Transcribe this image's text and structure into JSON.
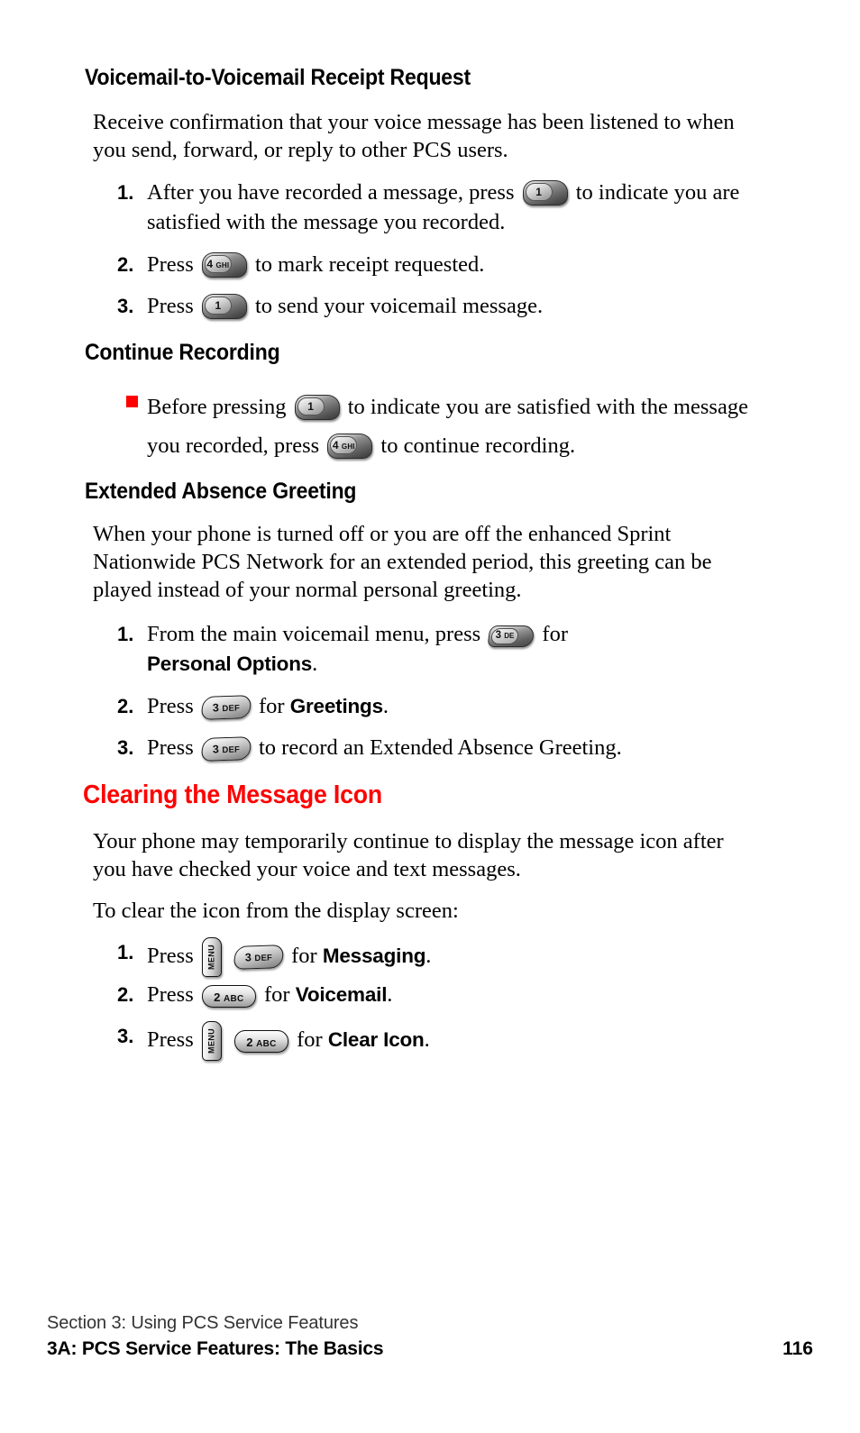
{
  "sections": {
    "voicemail_receipt": {
      "heading": "Voicemail-to-Voicemail Receipt Request",
      "intro": "Receive confirmation that your voice message has been listened to when you send, forward, or reply to other PCS users.",
      "steps": [
        {
          "number": "1.",
          "text_before": "After you have recorded a message, press",
          "key": "1",
          "text_after": "to indicate you are satisfied with the message you recorded."
        },
        {
          "number": "2.",
          "text_before": "Press",
          "key": "4 GHI",
          "text_after": "to mark receipt requested."
        },
        {
          "number": "3.",
          "text_before": "Press",
          "key": "1",
          "text_after": "to send your voicemail message."
        }
      ]
    },
    "continue_recording": {
      "heading": "Continue Recording",
      "bullet": {
        "text_before": "Before pressing",
        "key1": "1",
        "text_middle": "to indicate you are satisfied with the message you recorded, press",
        "key2": "4 GHI",
        "text_after": "to continue recording."
      }
    },
    "extended_absence": {
      "heading": "Extended Absence Greeting",
      "intro": "When your phone is turned off or you are off the enhanced Sprint Nationwide PCS Network for an extended period, this greeting can be played instead of your normal personal greeting.",
      "steps": [
        {
          "number": "1.",
          "text_before": "From the main voicemail menu, press",
          "key": "3 DE",
          "text_after": "for",
          "emphasis": "Personal Options",
          "text_end": "."
        },
        {
          "number": "2.",
          "text_before": "Press",
          "key": "3 DEF",
          "text_after": "for",
          "emphasis": "Greetings",
          "text_end": "."
        },
        {
          "number": "3.",
          "text_before": "Press",
          "key": "3 DEF",
          "text_after": "to record an Extended Absence Greeting.",
          "emphasis": "",
          "text_end": ""
        }
      ]
    },
    "clearing_message_icon": {
      "heading": "Clearing the Message Icon",
      "heading_color": "#ff0000",
      "intro": "Your phone may temporarily continue to display the message icon after you have checked your voice and text messages.",
      "lead_in": "To clear the icon from the display screen:",
      "steps": [
        {
          "number": "1.",
          "text_before": "Press",
          "key_menu": "MENU",
          "key": "3 DEF",
          "text_after": "for",
          "emphasis": "Messaging",
          "text_end": "."
        },
        {
          "number": "2.",
          "text_before": "Press",
          "key_menu": "",
          "key": "2 ABC",
          "text_after": "for",
          "emphasis": "Voicemail",
          "text_end": "."
        },
        {
          "number": "3.",
          "text_before": "Press",
          "key_menu": "MENU",
          "key": "2 ABC",
          "text_after": "for",
          "emphasis": "Clear Icon",
          "text_end": "."
        }
      ]
    }
  },
  "keys": {
    "one": {
      "digit": "1",
      "letters": ""
    },
    "two": {
      "digit": "2",
      "letters": "ABC"
    },
    "three": {
      "digit": "3",
      "letters": "DEF"
    },
    "three_partial": {
      "digit": "3",
      "letters": "DE"
    },
    "four": {
      "digit": "4",
      "letters": "GHI"
    },
    "menu": {
      "label": "MENU"
    }
  },
  "footer": {
    "section": "Section 3: Using PCS Service Features",
    "chapter": "3A: PCS Service Features: The Basics",
    "page_number": "116"
  }
}
